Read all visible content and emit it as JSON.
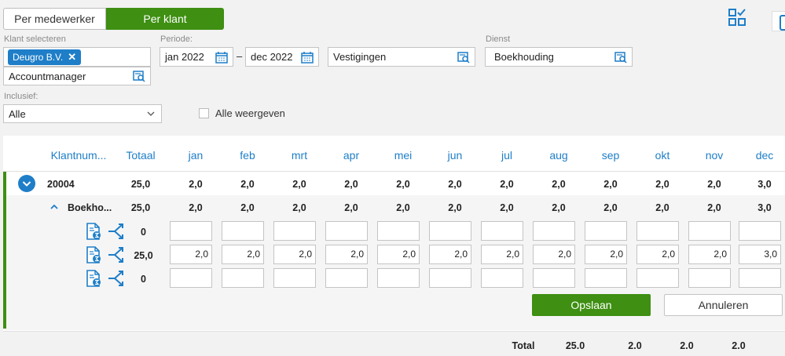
{
  "toggle": {
    "per_employee": "Per medewerker",
    "per_client": "Per klant"
  },
  "filters": {
    "client_label": "Klant selecteren",
    "client_chip": "Deugro B.V.",
    "accountmanager": "Accountmanager",
    "period_label": "Periode:",
    "period_from": "jan 2022",
    "period_dash": "–",
    "period_to": "dec 2022",
    "locations": "Vestigingen",
    "service_label": "Dienst",
    "service": "Boekhouding",
    "inclusive_label": "Inclusief:",
    "inclusive_value": "Alle",
    "show_all": "Alle weergeven"
  },
  "table": {
    "headers": [
      "Klantnum...",
      "Totaal",
      "jan",
      "feb",
      "mrt",
      "apr",
      "mei",
      "jun",
      "jul",
      "aug",
      "sep",
      "okt",
      "nov",
      "dec"
    ],
    "client_row": {
      "id": "20004",
      "total": "25,0",
      "months": [
        "2,0",
        "2,0",
        "2,0",
        "2,0",
        "2,0",
        "2,0",
        "2,0",
        "2,0",
        "2,0",
        "2,0",
        "2,0",
        "3,0"
      ]
    },
    "service_row": {
      "name": "Boekho...",
      "total": "25,0",
      "months": [
        "2,0",
        "2,0",
        "2,0",
        "2,0",
        "2,0",
        "2,0",
        "2,0",
        "2,0",
        "2,0",
        "2,0",
        "2,0",
        "3,0"
      ]
    },
    "input_rows": [
      {
        "total": "0",
        "months": [
          "",
          "",
          "",
          "",
          "",
          "",
          "",
          "",
          "",
          "",
          "",
          ""
        ]
      },
      {
        "total": "25,0",
        "months": [
          "2,0",
          "2,0",
          "2,0",
          "2,0",
          "2,0",
          "2,0",
          "2,0",
          "2,0",
          "2,0",
          "2,0",
          "2,0",
          "3,0"
        ]
      },
      {
        "total": "0",
        "months": [
          "",
          "",
          "",
          "",
          "",
          "",
          "",
          "",
          "",
          "",
          "",
          ""
        ]
      }
    ],
    "save": "Opslaan",
    "cancel": "Annuleren",
    "footer": {
      "label": "Total",
      "total": "25.0",
      "months": [
        "2.0",
        "2.0",
        "2.0"
      ]
    }
  },
  "colors": {
    "accent_green": "#3e8f12",
    "accent_blue": "#1e7ec8"
  }
}
